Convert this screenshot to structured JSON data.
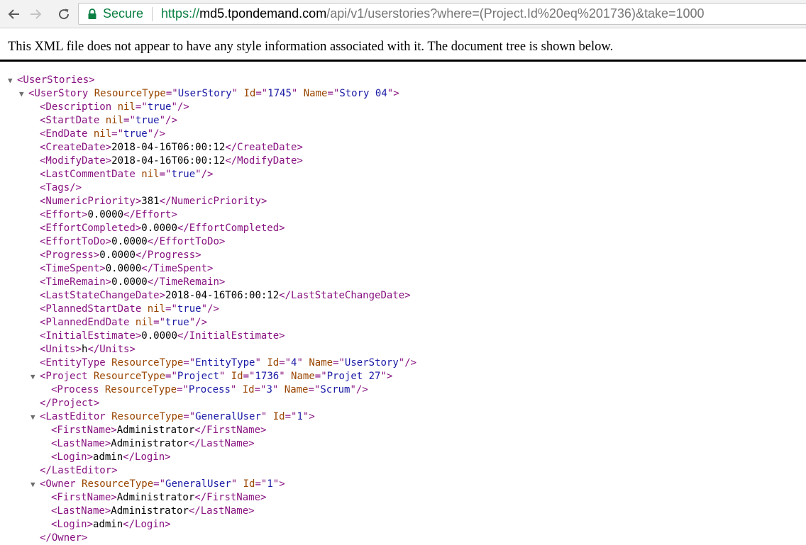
{
  "browser": {
    "secure_label": "Secure",
    "url": {
      "scheme": "https://",
      "host": "md5.tpondemand.com",
      "path": "/api/v1/userstories?where=(Project.Id%20eq%201736)&take=1000"
    }
  },
  "viewer": {
    "info_message": "This XML file does not appear to have any style information associated with it. The document tree is shown below."
  },
  "tree": [
    {
      "indent": 0,
      "toggle": true,
      "parts": [
        [
          "tag",
          "<UserStories>"
        ]
      ]
    },
    {
      "indent": 1,
      "toggle": true,
      "parts": [
        [
          "tag",
          "<UserStory "
        ],
        [
          "attr",
          "ResourceType"
        ],
        [
          "tag",
          "=\""
        ],
        [
          "val",
          "UserStory"
        ],
        [
          "tag",
          "\" "
        ],
        [
          "attr",
          "Id"
        ],
        [
          "tag",
          "=\""
        ],
        [
          "val",
          "1745"
        ],
        [
          "tag",
          "\" "
        ],
        [
          "attr",
          "Name"
        ],
        [
          "tag",
          "=\""
        ],
        [
          "val",
          "Story 04"
        ],
        [
          "tag",
          "\">"
        ]
      ]
    },
    {
      "indent": 2,
      "toggle": false,
      "parts": [
        [
          "tag",
          "<Description "
        ],
        [
          "attr",
          "nil"
        ],
        [
          "tag",
          "=\""
        ],
        [
          "val",
          "true"
        ],
        [
          "tag",
          "\"/>"
        ]
      ]
    },
    {
      "indent": 2,
      "toggle": false,
      "parts": [
        [
          "tag",
          "<StartDate "
        ],
        [
          "attr",
          "nil"
        ],
        [
          "tag",
          "=\""
        ],
        [
          "val",
          "true"
        ],
        [
          "tag",
          "\"/>"
        ]
      ]
    },
    {
      "indent": 2,
      "toggle": false,
      "parts": [
        [
          "tag",
          "<EndDate "
        ],
        [
          "attr",
          "nil"
        ],
        [
          "tag",
          "=\""
        ],
        [
          "val",
          "true"
        ],
        [
          "tag",
          "\"/>"
        ]
      ]
    },
    {
      "indent": 2,
      "toggle": false,
      "parts": [
        [
          "tag",
          "<CreateDate>"
        ],
        [
          "txt",
          "2018-04-16T06:00:12"
        ],
        [
          "tag",
          "</CreateDate>"
        ]
      ]
    },
    {
      "indent": 2,
      "toggle": false,
      "parts": [
        [
          "tag",
          "<ModifyDate>"
        ],
        [
          "txt",
          "2018-04-16T06:00:12"
        ],
        [
          "tag",
          "</ModifyDate>"
        ]
      ]
    },
    {
      "indent": 2,
      "toggle": false,
      "parts": [
        [
          "tag",
          "<LastCommentDate "
        ],
        [
          "attr",
          "nil"
        ],
        [
          "tag",
          "=\""
        ],
        [
          "val",
          "true"
        ],
        [
          "tag",
          "\"/>"
        ]
      ]
    },
    {
      "indent": 2,
      "toggle": false,
      "parts": [
        [
          "tag",
          "<Tags/>"
        ]
      ]
    },
    {
      "indent": 2,
      "toggle": false,
      "parts": [
        [
          "tag",
          "<NumericPriority>"
        ],
        [
          "txt",
          "381"
        ],
        [
          "tag",
          "</NumericPriority>"
        ]
      ]
    },
    {
      "indent": 2,
      "toggle": false,
      "parts": [
        [
          "tag",
          "<Effort>"
        ],
        [
          "txt",
          "0.0000"
        ],
        [
          "tag",
          "</Effort>"
        ]
      ]
    },
    {
      "indent": 2,
      "toggle": false,
      "parts": [
        [
          "tag",
          "<EffortCompleted>"
        ],
        [
          "txt",
          "0.0000"
        ],
        [
          "tag",
          "</EffortCompleted>"
        ]
      ]
    },
    {
      "indent": 2,
      "toggle": false,
      "parts": [
        [
          "tag",
          "<EffortToDo>"
        ],
        [
          "txt",
          "0.0000"
        ],
        [
          "tag",
          "</EffortToDo>"
        ]
      ]
    },
    {
      "indent": 2,
      "toggle": false,
      "parts": [
        [
          "tag",
          "<Progress>"
        ],
        [
          "txt",
          "0.0000"
        ],
        [
          "tag",
          "</Progress>"
        ]
      ]
    },
    {
      "indent": 2,
      "toggle": false,
      "parts": [
        [
          "tag",
          "<TimeSpent>"
        ],
        [
          "txt",
          "0.0000"
        ],
        [
          "tag",
          "</TimeSpent>"
        ]
      ]
    },
    {
      "indent": 2,
      "toggle": false,
      "parts": [
        [
          "tag",
          "<TimeRemain>"
        ],
        [
          "txt",
          "0.0000"
        ],
        [
          "tag",
          "</TimeRemain>"
        ]
      ]
    },
    {
      "indent": 2,
      "toggle": false,
      "parts": [
        [
          "tag",
          "<LastStateChangeDate>"
        ],
        [
          "txt",
          "2018-04-16T06:00:12"
        ],
        [
          "tag",
          "</LastStateChangeDate>"
        ]
      ]
    },
    {
      "indent": 2,
      "toggle": false,
      "parts": [
        [
          "tag",
          "<PlannedStartDate "
        ],
        [
          "attr",
          "nil"
        ],
        [
          "tag",
          "=\""
        ],
        [
          "val",
          "true"
        ],
        [
          "tag",
          "\"/>"
        ]
      ]
    },
    {
      "indent": 2,
      "toggle": false,
      "parts": [
        [
          "tag",
          "<PlannedEndDate "
        ],
        [
          "attr",
          "nil"
        ],
        [
          "tag",
          "=\""
        ],
        [
          "val",
          "true"
        ],
        [
          "tag",
          "\"/>"
        ]
      ]
    },
    {
      "indent": 2,
      "toggle": false,
      "parts": [
        [
          "tag",
          "<InitialEstimate>"
        ],
        [
          "txt",
          "0.0000"
        ],
        [
          "tag",
          "</InitialEstimate>"
        ]
      ]
    },
    {
      "indent": 2,
      "toggle": false,
      "parts": [
        [
          "tag",
          "<Units>"
        ],
        [
          "txt",
          "h"
        ],
        [
          "tag",
          "</Units>"
        ]
      ]
    },
    {
      "indent": 2,
      "toggle": false,
      "parts": [
        [
          "tag",
          "<EntityType "
        ],
        [
          "attr",
          "ResourceType"
        ],
        [
          "tag",
          "=\""
        ],
        [
          "val",
          "EntityType"
        ],
        [
          "tag",
          "\" "
        ],
        [
          "attr",
          "Id"
        ],
        [
          "tag",
          "=\""
        ],
        [
          "val",
          "4"
        ],
        [
          "tag",
          "\" "
        ],
        [
          "attr",
          "Name"
        ],
        [
          "tag",
          "=\""
        ],
        [
          "val",
          "UserStory"
        ],
        [
          "tag",
          "\"/>"
        ]
      ]
    },
    {
      "indent": 2,
      "toggle": true,
      "parts": [
        [
          "tag",
          "<Project "
        ],
        [
          "attr",
          "ResourceType"
        ],
        [
          "tag",
          "=\""
        ],
        [
          "val",
          "Project"
        ],
        [
          "tag",
          "\" "
        ],
        [
          "attr",
          "Id"
        ],
        [
          "tag",
          "=\""
        ],
        [
          "val",
          "1736"
        ],
        [
          "tag",
          "\" "
        ],
        [
          "attr",
          "Name"
        ],
        [
          "tag",
          "=\""
        ],
        [
          "val",
          "Projet 27"
        ],
        [
          "tag",
          "\">"
        ]
      ]
    },
    {
      "indent": 3,
      "toggle": false,
      "parts": [
        [
          "tag",
          "<Process "
        ],
        [
          "attr",
          "ResourceType"
        ],
        [
          "tag",
          "=\""
        ],
        [
          "val",
          "Process"
        ],
        [
          "tag",
          "\" "
        ],
        [
          "attr",
          "Id"
        ],
        [
          "tag",
          "=\""
        ],
        [
          "val",
          "3"
        ],
        [
          "tag",
          "\" "
        ],
        [
          "attr",
          "Name"
        ],
        [
          "tag",
          "=\""
        ],
        [
          "val",
          "Scrum"
        ],
        [
          "tag",
          "\"/>"
        ]
      ]
    },
    {
      "indent": 2,
      "toggle": false,
      "parts": [
        [
          "tag",
          "</Project>"
        ]
      ]
    },
    {
      "indent": 2,
      "toggle": true,
      "parts": [
        [
          "tag",
          "<LastEditor "
        ],
        [
          "attr",
          "ResourceType"
        ],
        [
          "tag",
          "=\""
        ],
        [
          "val",
          "GeneralUser"
        ],
        [
          "tag",
          "\" "
        ],
        [
          "attr",
          "Id"
        ],
        [
          "tag",
          "=\""
        ],
        [
          "val",
          "1"
        ],
        [
          "tag",
          "\">"
        ]
      ]
    },
    {
      "indent": 3,
      "toggle": false,
      "parts": [
        [
          "tag",
          "<FirstName>"
        ],
        [
          "txt",
          "Administrator"
        ],
        [
          "tag",
          "</FirstName>"
        ]
      ]
    },
    {
      "indent": 3,
      "toggle": false,
      "parts": [
        [
          "tag",
          "<LastName>"
        ],
        [
          "txt",
          "Administrator"
        ],
        [
          "tag",
          "</LastName>"
        ]
      ]
    },
    {
      "indent": 3,
      "toggle": false,
      "parts": [
        [
          "tag",
          "<Login>"
        ],
        [
          "txt",
          "admin"
        ],
        [
          "tag",
          "</Login>"
        ]
      ]
    },
    {
      "indent": 2,
      "toggle": false,
      "parts": [
        [
          "tag",
          "</LastEditor>"
        ]
      ]
    },
    {
      "indent": 2,
      "toggle": true,
      "parts": [
        [
          "tag",
          "<Owner "
        ],
        [
          "attr",
          "ResourceType"
        ],
        [
          "tag",
          "=\""
        ],
        [
          "val",
          "GeneralUser"
        ],
        [
          "tag",
          "\" "
        ],
        [
          "attr",
          "Id"
        ],
        [
          "tag",
          "=\""
        ],
        [
          "val",
          "1"
        ],
        [
          "tag",
          "\">"
        ]
      ]
    },
    {
      "indent": 3,
      "toggle": false,
      "parts": [
        [
          "tag",
          "<FirstName>"
        ],
        [
          "txt",
          "Administrator"
        ],
        [
          "tag",
          "</FirstName>"
        ]
      ]
    },
    {
      "indent": 3,
      "toggle": false,
      "parts": [
        [
          "tag",
          "<LastName>"
        ],
        [
          "txt",
          "Administrator"
        ],
        [
          "tag",
          "</LastName>"
        ]
      ]
    },
    {
      "indent": 3,
      "toggle": false,
      "parts": [
        [
          "tag",
          "<Login>"
        ],
        [
          "txt",
          "admin"
        ],
        [
          "tag",
          "</Login>"
        ]
      ]
    },
    {
      "indent": 2,
      "toggle": false,
      "parts": [
        [
          "tag",
          "</Owner>"
        ]
      ]
    }
  ],
  "colors": {
    "tag": "#881280",
    "attr_name": "#994500",
    "attr_value": "#1a1aa6",
    "text": "#000000",
    "secure": "#0b8043"
  },
  "icons": {
    "back": "arrow-left-icon",
    "forward": "arrow-right-icon",
    "reload": "reload-icon",
    "lock": "lock-icon",
    "toggle": "triangle-down-icon"
  }
}
